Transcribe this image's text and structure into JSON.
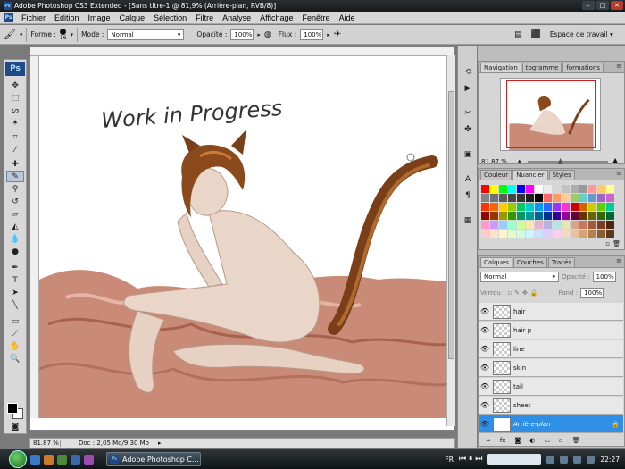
{
  "titlebar": {
    "title": "Adobe Photoshop CS3 Extended - [Sans titre-1 @ 81,9% (Arrière-plan, RVB/8)]"
  },
  "menu": [
    "Fichier",
    "Edition",
    "Image",
    "Calque",
    "Sélection",
    "Filtre",
    "Analyse",
    "Affichage",
    "Fenêtre",
    "Aide"
  ],
  "options": {
    "forme_label": "Forme :",
    "brush_size": "16",
    "mode_label": "Mode :",
    "mode_value": "Normal",
    "opacite_label": "Opacité :",
    "opacite_value": "100%",
    "flux_label": "Flux :",
    "flux_value": "100%",
    "workspace": "Espace de travail ▾"
  },
  "canvas": {
    "wip_text": "Work in Progress",
    "colors": {
      "hair": "#8a4a1c",
      "skin": "#e9d6c8",
      "sheet": "#c98a78",
      "tail": "#7a3e18"
    }
  },
  "status": {
    "zoom": "81.87 %",
    "doc": "Doc : 2,05 Mo/9,30 Mo"
  },
  "panels": {
    "navigator_tabs": [
      "Navigation",
      "togramme",
      "formations"
    ],
    "navigator_zoom": "81.87 %",
    "navigator_zoom_fraction": 0.4,
    "color_tabs": [
      "Couleur",
      "Nuancier",
      "Styles"
    ],
    "layers_tabs": [
      "Calques",
      "Couches",
      "Tracés"
    ],
    "blend_mode": "Normal",
    "opacite_label": "Opacité :",
    "opacite_value": "100%",
    "verrou_label": "Verrou :",
    "fond_label": "Fond :",
    "fond_value": "100%",
    "layers": [
      {
        "name": "hair",
        "selected": false
      },
      {
        "name": "hair p",
        "selected": false
      },
      {
        "name": "line",
        "selected": false
      },
      {
        "name": "skin",
        "selected": false
      },
      {
        "name": "tail",
        "selected": false
      },
      {
        "name": "sheet",
        "selected": false
      },
      {
        "name": "Arrière-plan",
        "selected": true
      }
    ]
  },
  "swatch_colors": [
    "#ff0000",
    "#ffff00",
    "#00ff00",
    "#00ffff",
    "#0000ff",
    "#ff00ff",
    "#ffffff",
    "#ebebeb",
    "#d6d6d6",
    "#c2c2c2",
    "#adadad",
    "#999999",
    "#ff9999",
    "#ffcc66",
    "#ffff99",
    "#858585",
    "#707070",
    "#5c5c5c",
    "#474747",
    "#333333",
    "#1f1f1f",
    "#000000",
    "#ff6666",
    "#ff9966",
    "#ffcc99",
    "#99cc66",
    "#66cccc",
    "#6699cc",
    "#9966cc",
    "#cc66cc",
    "#ff3300",
    "#ff6600",
    "#ffcc00",
    "#99cc00",
    "#00cc66",
    "#00cccc",
    "#0099ff",
    "#3366ff",
    "#9933ff",
    "#ff33cc",
    "#cc0000",
    "#cc6600",
    "#cccc00",
    "#66cc00",
    "#00cc99",
    "#990000",
    "#993300",
    "#999900",
    "#339900",
    "#009966",
    "#009999",
    "#006699",
    "#003399",
    "#330099",
    "#990099",
    "#660033",
    "#663300",
    "#666600",
    "#336600",
    "#006633",
    "#ff99cc",
    "#cc99ff",
    "#99ccff",
    "#99ffcc",
    "#ccff99",
    "#ffe5b3",
    "#e6b3cc",
    "#b3b3e6",
    "#b3e6e6",
    "#e6e6b3",
    "#d9a38c",
    "#c47a5c",
    "#a05a3c",
    "#7a3e22",
    "#4d2612",
    "#ffcccc",
    "#ffe0cc",
    "#fff5cc",
    "#e0ffcc",
    "#ccffe0",
    "#ccf5ff",
    "#cce0ff",
    "#e0ccff",
    "#ffccf5",
    "#f2d9c4",
    "#e8c29e",
    "#d4a373",
    "#b5824f",
    "#8c5f33",
    "#5c3b1c"
  ],
  "taskbar": {
    "task_label": "Adobe Photoshop C...",
    "lang": "FR",
    "time": "22:27"
  }
}
